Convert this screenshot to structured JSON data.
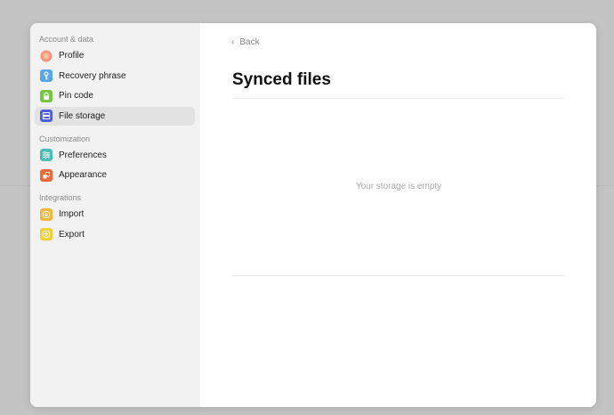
{
  "sidebar": {
    "sections": [
      {
        "title": "Account & data",
        "items": [
          {
            "label": "Profile",
            "icon": "profile-orb-icon",
            "color": "#f4a186"
          },
          {
            "label": "Recovery phrase",
            "icon": "key-icon",
            "color": "#5aa7e6"
          },
          {
            "label": "Pin code",
            "icon": "lock-icon",
            "color": "#79c544"
          },
          {
            "label": "File storage",
            "icon": "storage-icon",
            "color": "#4b5ed6",
            "active": true
          }
        ]
      },
      {
        "title": "Customization",
        "items": [
          {
            "label": "Preferences",
            "icon": "sliders-icon",
            "color": "#4bbfb3"
          },
          {
            "label": "Appearance",
            "icon": "palette-icon",
            "color": "#ec6a3a"
          }
        ]
      },
      {
        "title": "Integrations",
        "items": [
          {
            "label": "Import",
            "icon": "import-icon",
            "color": "#f2b73f"
          },
          {
            "label": "Export",
            "icon": "export-icon",
            "color": "#f0cf3a"
          }
        ]
      }
    ]
  },
  "main": {
    "back_label": "Back",
    "title": "Synced files",
    "empty_message": "Your storage is empty"
  }
}
